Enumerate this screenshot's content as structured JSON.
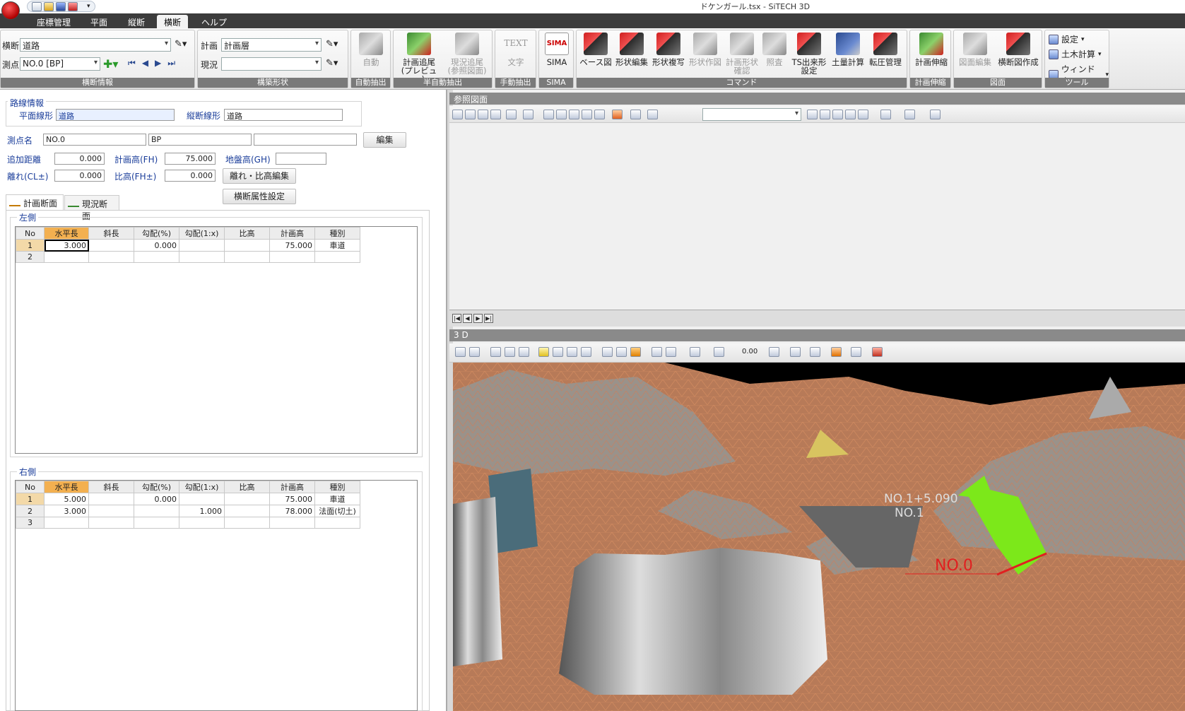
{
  "window": {
    "title": "ドケンガール.tsx - SiTECH 3D"
  },
  "menubar": {
    "tabs": [
      "座標管理",
      "平面",
      "縦断",
      "横断",
      "ヘルプ"
    ],
    "active": "横断"
  },
  "ribbon": {
    "cross_info": {
      "label_cross": "横断",
      "cross_value": "道路",
      "label_point": "測点",
      "point_value": "NO.0 [BP]",
      "group_label": "横断情報"
    },
    "structure": {
      "label_plan": "計画",
      "plan_value": "計画層",
      "label_current": "現況",
      "current_value": "",
      "group_label": "構築形状"
    },
    "auto": {
      "btn": "自動",
      "group_label": "自動抽出"
    },
    "semi": {
      "btn1": "計画追尾\n(プレビュー)",
      "btn2": "現況追尾\n(参照図面)",
      "group_label": "半自動抽出"
    },
    "manual": {
      "icon_text": "TEXT",
      "btn": "文字",
      "group_label": "手動抽出"
    },
    "sima": {
      "icon_text": "SIMA",
      "btn": "SIMA",
      "group_label": "SIMA"
    },
    "command": {
      "buttons": [
        "ベース図",
        "形状編集",
        "形状複写",
        "形状作図",
        "計画形状\n確認",
        "照査",
        "TS出来形\n設定",
        "土量計算",
        "転圧管理"
      ],
      "group_label": "コマンド"
    },
    "scale": {
      "btn": "計画伸縮",
      "group_label": "計画伸縮"
    },
    "drawing": {
      "btn1": "図面編集",
      "btn2": "横断図作成",
      "group_label": "図面"
    },
    "tools": {
      "items": [
        "設定",
        "土木計算",
        "ウィンドウ"
      ],
      "group_label": "ツール"
    }
  },
  "left": {
    "route": {
      "legend": "路線情報",
      "plan_label": "平面線形",
      "plan_value": "道路",
      "profile_label": "縦断線形",
      "profile_value": "道路"
    },
    "station": {
      "label": "測点名",
      "name1": "NO.0",
      "name2": "BP",
      "name3": "",
      "edit_btn": "編集"
    },
    "fields": {
      "add_dist_label": "追加距離",
      "add_dist": "0.000",
      "fh_label": "計画高(FH)",
      "fh": "75.000",
      "gh_label": "地盤高(GH)",
      "gh": "",
      "cl_label": "離れ(CL±)",
      "cl": "0.000",
      "fhpm_label": "比高(FH±)",
      "fhpm": "0.000",
      "offset_btn": "離れ・比高編集",
      "attr_btn": "横断属性設定"
    },
    "tabs": {
      "plan": "計画断面",
      "current": "現況断面"
    },
    "headers": [
      "No",
      "水平長",
      "斜長",
      "勾配(%)",
      "勾配(1:x)",
      "比高",
      "計画高",
      "種別"
    ],
    "left_side": {
      "legend": "左側",
      "rows": [
        [
          "1",
          "3.000",
          "",
          "0.000",
          "",
          "",
          "75.000",
          "車道"
        ],
        [
          "2",
          "",
          "",
          "",
          "",
          "",
          "",
          ""
        ]
      ]
    },
    "right_side": {
      "legend": "右側",
      "rows": [
        [
          "1",
          "5.000",
          "",
          "0.000",
          "",
          "",
          "75.000",
          "車道"
        ],
        [
          "2",
          "3.000",
          "",
          "",
          "1.000",
          "",
          "78.000",
          "法面(切土)"
        ],
        [
          "3",
          "",
          "",
          "",
          "",
          "",
          "",
          ""
        ]
      ]
    }
  },
  "reference": {
    "title": "参照図面",
    "combo_value": ""
  },
  "view3d": {
    "title": "3 D",
    "scale_value": "0.00",
    "labels": [
      "NO.1+5.090",
      "NO.1",
      "NO.0"
    ]
  }
}
